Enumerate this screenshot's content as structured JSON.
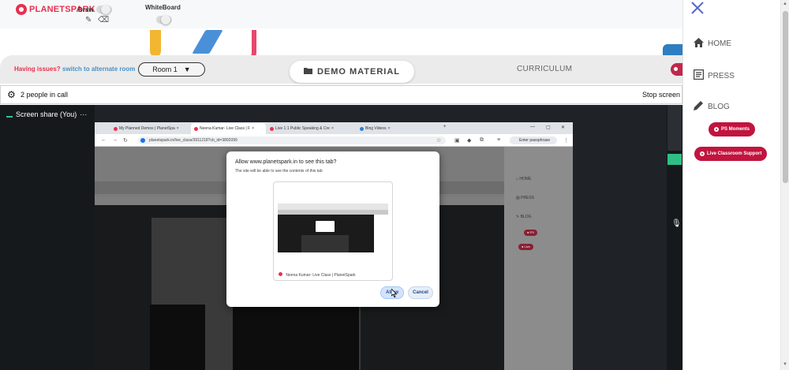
{
  "brand": {
    "logo_text": "PLANETSPARK"
  },
  "toolbar": {
    "draw_label": "Draw",
    "whiteboard_label": "WhiteBoard"
  },
  "issues": {
    "prefix": "Having issues?",
    "link": "switch to alternate room"
  },
  "room": {
    "selected": "Room 1",
    "arrow": "▼"
  },
  "demo": {
    "label": "DEMO MATERIAL"
  },
  "curriculum": {
    "label": "CURRICULUM"
  },
  "call": {
    "people": "2 people in call",
    "stop": "Stop screen"
  },
  "share": {
    "label": "Screen share (You)",
    "more": "···"
  },
  "browser": {
    "tabs": [
      {
        "label": "My Planned Demos | PlanetSpa",
        "close": "×"
      },
      {
        "label": "Neena Kumar- Live Class | F",
        "close": "×"
      },
      {
        "label": "Live 1:1 Public Speaking & Cre",
        "close": "×"
      },
      {
        "label": "Bing Videos",
        "close": "×"
      }
    ],
    "new_tab": "+",
    "url": "planetspark.in/live_class/3911218?cb_id=3892099",
    "passcode": "Enter passphrase"
  },
  "dialog": {
    "title": "Allow www.planetspark.in to see this tab?",
    "subtitle": "The site will be able to see the contents of this tab",
    "preview_caption": "Neena Kumar- Live Class | PlanetSpark",
    "allow": "Allow",
    "cancel": "Cancel"
  },
  "sidebar": {
    "items": [
      {
        "label": "HOME",
        "icon": "home-icon"
      },
      {
        "label": "PRESS",
        "icon": "newspaper-icon"
      },
      {
        "label": "BLOG",
        "icon": "pencil-icon"
      }
    ],
    "pills": [
      {
        "label": "PS Moments"
      },
      {
        "label": "Live Classroom Support"
      }
    ]
  },
  "colors": {
    "brand_red": "#e8304f",
    "pill_red": "#c2143e",
    "link_blue": "#4a90c8",
    "share_bg": "#1f2328"
  }
}
